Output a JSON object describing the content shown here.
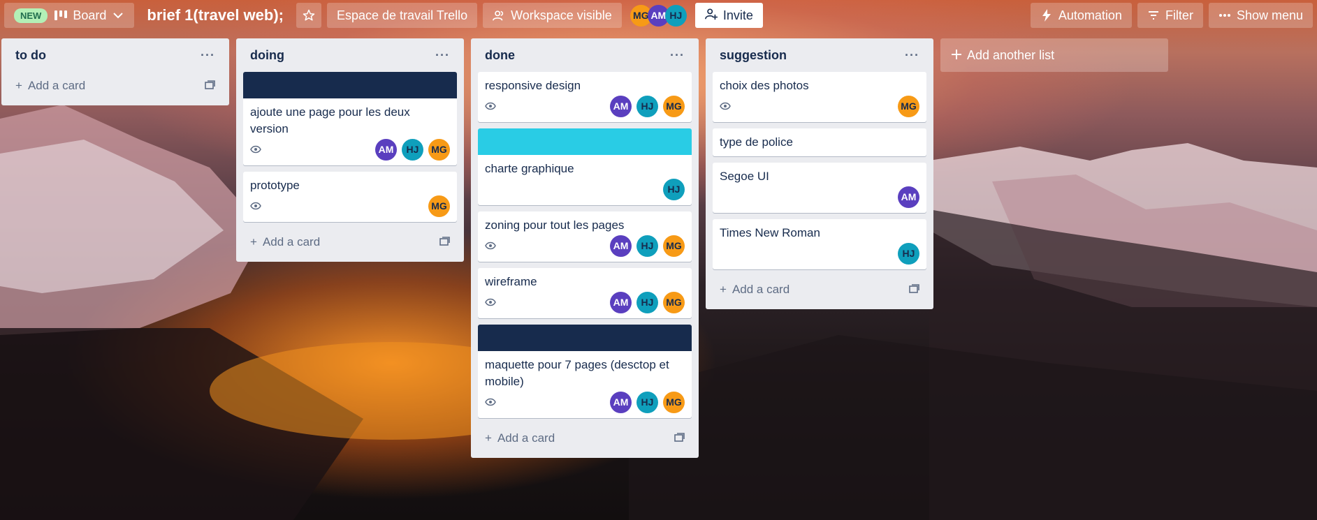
{
  "header": {
    "new_badge": "NEW",
    "board_view_label": "Board",
    "board_title": "brief 1(travel web);",
    "workspace_label": "Espace de travail Trello",
    "visibility_label": "Workspace visible",
    "members": [
      "MG",
      "AM",
      "HJ"
    ],
    "invite_label": "Invite",
    "automation_label": "Automation",
    "filter_label": "Filter",
    "show_menu_label": "Show menu"
  },
  "lists": [
    {
      "title": "to do",
      "add_card_label": "Add a card",
      "cards": []
    },
    {
      "title": "doing",
      "add_card_label": "Add a card",
      "cards": [
        {
          "title": "ajoute une page pour les deux version",
          "cover": "#172b4d",
          "members": [
            "AM",
            "HJ",
            "MG"
          ]
        },
        {
          "title": "prototype",
          "members": [
            "MG"
          ]
        }
      ]
    },
    {
      "title": "done",
      "add_card_label": "Add a card",
      "cards": [
        {
          "title": "responsive design",
          "members": [
            "AM",
            "HJ",
            "MG"
          ]
        },
        {
          "title": "charte graphique",
          "cover": "#29cce5",
          "members": [
            "HJ"
          ]
        },
        {
          "title": "zoning pour tout les pages",
          "members": [
            "AM",
            "HJ",
            "MG"
          ]
        },
        {
          "title": "wireframe",
          "members": [
            "AM",
            "HJ",
            "MG"
          ]
        },
        {
          "title": "maquette pour 7 pages (desctop et mobile)",
          "cover": "#172b4d",
          "members": [
            "AM",
            "HJ",
            "MG"
          ]
        }
      ]
    },
    {
      "title": "suggestion",
      "add_card_label": "Add a card",
      "cards": [
        {
          "title": "choix des photos",
          "members": [
            "MG"
          ]
        },
        {
          "title": "type de police",
          "members": []
        },
        {
          "title": "Segoe UI",
          "members": [
            "AM"
          ]
        },
        {
          "title": "Times New Roman",
          "members": [
            "HJ"
          ]
        }
      ]
    }
  ],
  "add_list_label": "Add another list",
  "colors": {
    "mg": "#f79a16",
    "am": "#5a3fbf",
    "hj": "#0f9fbc",
    "cover_dark": "#172b4d",
    "cover_cyan": "#29cce5"
  }
}
